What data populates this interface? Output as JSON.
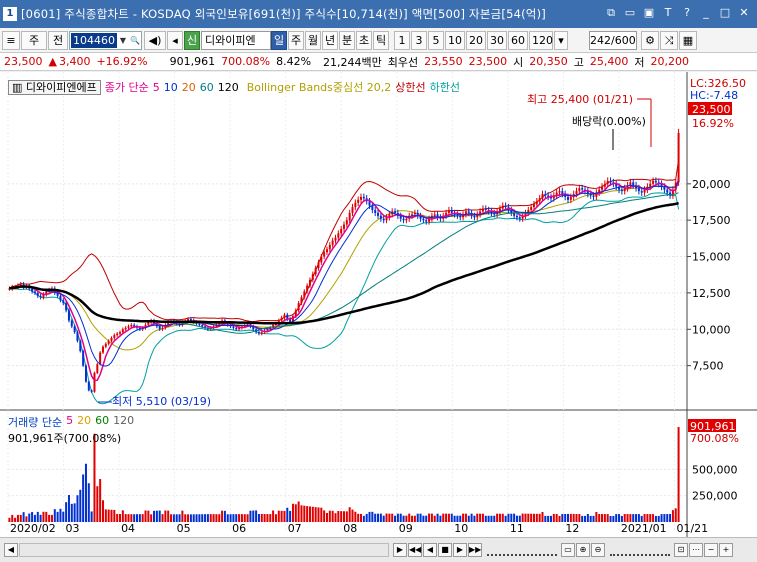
{
  "window": {
    "badge": "1",
    "title": "[0601] 주식종합차트 - KOSDAQ 외국인보유[691(천)] 주식수[10,714(천)] 액면[500] 자본금[54(억)]"
  },
  "toolbar": {
    "market": "주",
    "total": "전",
    "code": "104460",
    "stock_name": "디와이피엔",
    "check_label": "신",
    "periods": [
      "일",
      "주",
      "월",
      "년",
      "분",
      "초",
      "틱"
    ],
    "active_period": "일",
    "numbers": [
      "1",
      "3",
      "5",
      "10",
      "20",
      "30",
      "60",
      "120"
    ],
    "period_value": "242",
    "period_max": "/600"
  },
  "quote": {
    "price": "23,500",
    "change": "3,400",
    "change_pct": "+16.92%",
    "volume": "901,961",
    "vol_ratio": "700.08%",
    "turnover": "8.42%",
    "amount": "21,244백만",
    "pref_label": "최우선",
    "ask": "23,550",
    "bid": "23,500",
    "open_label": "시",
    "open": "20,350",
    "high_label": "고",
    "high": "25,400",
    "low_label": "저",
    "low": "20,200"
  },
  "legend": {
    "stock": "디와이피엔에프",
    "ma_label": "종가 단순",
    "ma": [
      "5",
      "10",
      "20",
      "60",
      "120"
    ],
    "bb": "Bollinger Bands중심선 20,2",
    "bb_upper": "상한선",
    "bb_lower": "하한선"
  },
  "vol_legend": {
    "label": "거래량 단순",
    "ma": [
      "5",
      "20",
      "60",
      "120"
    ],
    "value": "901,961주(700.08%)"
  },
  "right_info": {
    "lc": "LC:326.50",
    "hc": "HC:-7.48",
    "price_tag": "23,500",
    "pct_tag": "16.92%",
    "vol_tag": "901,961",
    "vol_pct_tag": "700.08%"
  },
  "annotations": {
    "high": "최고 25,400 (01/21)",
    "dividend": "배당락(0.00%)",
    "low": "최저 5,510 (03/19)"
  },
  "colors": {
    "up": "#e00000",
    "down": "#0030d0",
    "ma5": "#e0008a",
    "ma120": "#000000",
    "bb": "#c00000",
    "bb_lower": "#00a0a0"
  },
  "chart_data": {
    "type": "candlestick",
    "price_axis": {
      "ticks": [
        "20,000",
        "17,500",
        "15,000",
        "12,500",
        "10,000",
        "7,500"
      ],
      "tick_values": [
        20000,
        17500,
        15000,
        12500,
        10000,
        7500
      ],
      "min": 5000,
      "max": 27000
    },
    "volume_axis": {
      "ticks": [
        "500,000",
        "250,000"
      ],
      "tick_values": [
        500000,
        250000
      ],
      "max": 950000
    },
    "x_ticks": [
      "2020/02",
      "03",
      "04",
      "05",
      "06",
      "07",
      "08",
      "09",
      "10",
      "11",
      "12",
      "2021/01",
      "01/21"
    ],
    "series": [
      {
        "name": "주가",
        "values": [
          12800,
          12900,
          12900,
          13000,
          13100,
          12900,
          12950,
          12800,
          12600,
          12500,
          12300,
          12200,
          12400,
          12600,
          12700,
          12800,
          12500,
          12300,
          12000,
          11800,
          11300,
          10600,
          10200,
          9800,
          9200,
          8500,
          7500,
          6400,
          5800,
          5700,
          7000,
          7600,
          8400,
          8800,
          9000,
          9200,
          9400,
          9600,
          9700,
          9800,
          10000,
          10100,
          10200,
          10300,
          10200,
          10100,
          10000,
          10100,
          10300,
          10500,
          10600,
          10400,
          10200,
          10000,
          10100,
          10300,
          10500,
          10600,
          10500,
          10400,
          10300,
          10500,
          10600,
          10700,
          10600,
          10500,
          10400,
          10300,
          10200,
          10100,
          10000,
          10100,
          10200,
          10300,
          10400,
          10600,
          10400,
          10300,
          10200,
          10100,
          10000,
          10100,
          10200,
          10300,
          10400,
          10200,
          10000,
          9800,
          9700,
          9800,
          9900,
          10000,
          10100,
          10300,
          10400,
          10600,
          10800,
          11000,
          10700,
          10500,
          10900,
          11300,
          11800,
          12200,
          12600,
          13000,
          13400,
          13800,
          14200,
          14600,
          15000,
          15300,
          15500,
          15800,
          16100,
          16300,
          16600,
          16900,
          17200,
          17500,
          18000,
          18400,
          18700,
          18900,
          19100,
          19000,
          18800,
          18500,
          18200,
          18000,
          17800,
          17600,
          17500,
          17700,
          17900,
          18100,
          18000,
          17800,
          17600,
          17500,
          17600,
          17800,
          17900,
          18000,
          17800,
          17600,
          17500,
          17400,
          17600,
          17800,
          17900,
          17700,
          17600,
          17800,
          18000,
          18200,
          18000,
          17900,
          17800,
          17700,
          17900,
          18100,
          18000,
          17800,
          17700,
          17900,
          18100,
          18300,
          18200,
          18100,
          18000,
          17900,
          18100,
          18300,
          18500,
          18400,
          18200,
          18000,
          17800,
          17700,
          17600,
          17800,
          18000,
          18200,
          18400,
          18600,
          18800,
          19000,
          19300,
          19200,
          19100,
          19000,
          19200,
          19400,
          19500,
          19300,
          19100,
          18900,
          19100,
          19300,
          19500,
          19700,
          19600,
          19500,
          19300,
          19200,
          19100,
          19400,
          19600,
          19800,
          20000,
          20200,
          20100,
          20000,
          19800,
          19600,
          19500,
          19700,
          19900,
          20100,
          19900,
          19700,
          19500,
          19400,
          19600,
          19800,
          20000,
          20200,
          20100,
          20000,
          19800,
          19600,
          19400,
          19200,
          19600,
          20100,
          23500
        ]
      }
    ]
  }
}
